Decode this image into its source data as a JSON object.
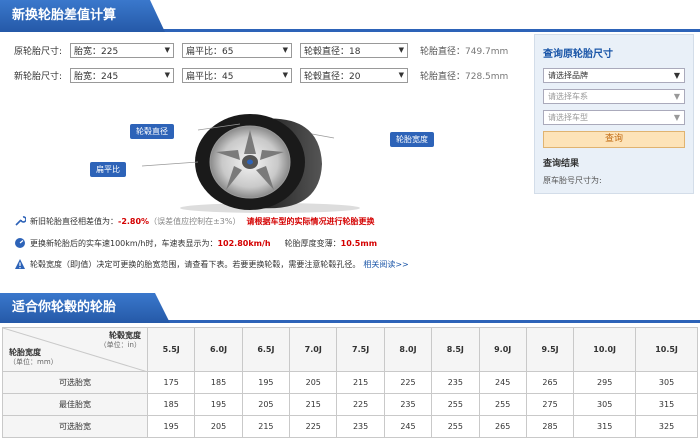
{
  "header": {
    "title": "新换轮胎差值计算"
  },
  "calc": {
    "original": {
      "label": "原轮胎尺寸:",
      "width_label": "胎宽：225",
      "ratio_label": "扁平比：65",
      "rim_label": "轮毂直径：18",
      "diameter_label": "轮胎直径：",
      "diameter_value": "749.7mm"
    },
    "new": {
      "label": "新轮胎尺寸:",
      "width_label": "胎宽：245",
      "ratio_label": "扁平比：45",
      "rim_label": "轮毂直径：20",
      "diameter_label": "轮胎直径：",
      "diameter_value": "728.5mm"
    }
  },
  "diagram": {
    "callout_rim": "轮毂直径",
    "callout_width": "轮胎宽度",
    "callout_ratio": "扁平比"
  },
  "sidebar": {
    "title": "查询原轮胎尺寸",
    "brand": "请选择品牌",
    "series": "请选择车系",
    "model": "请选择车型",
    "query_button": "查询",
    "result_title": "查询结果",
    "result_text": "原车胎号尺寸为:"
  },
  "info": {
    "line1_a": "新旧轮胎直径相差值为：",
    "line1_b": "-2.80%",
    "line1_c": "（误差值应控制在±3%）",
    "line1_d": "请根据车型的实际情况进行轮胎更换",
    "line2_a": "更换新轮胎后的实车速100km/h时，车速表显示为：",
    "line2_b": "102.80km/h",
    "line2_c": "轮胎厚度变薄：",
    "line2_d": "10.5mm",
    "line3_a": "轮毂宽度（即J值）决定可更换的胎宽范围，请查看下表。若要更换轮毂，需要注意轮毂孔径。",
    "line3_b": "相关阅读>>"
  },
  "section": {
    "title": "适合你轮毂的轮胎"
  },
  "table": {
    "corner_top": "轮毂宽度",
    "corner_top_unit": "（单位：in）",
    "corner_bottom": "轮胎宽度",
    "corner_bottom_unit": "（单位：mm）",
    "columns": [
      "5.5J",
      "6.0J",
      "6.5J",
      "7.0J",
      "7.5J",
      "8.0J",
      "8.5J",
      "9.0J",
      "9.5J",
      "10.0J",
      "10.5J"
    ],
    "rows": [
      {
        "label": "可选胎宽",
        "values": [
          "175",
          "185",
          "195",
          "205",
          "215",
          "225",
          "235",
          "245",
          "265",
          "295",
          "305"
        ]
      },
      {
        "label": "最佳胎宽",
        "values": [
          "185",
          "195",
          "205",
          "215",
          "225",
          "235",
          "255",
          "255",
          "275",
          "305",
          "315"
        ]
      },
      {
        "label": "可选胎宽",
        "values": [
          "195",
          "205",
          "215",
          "225",
          "235",
          "245",
          "255",
          "265",
          "285",
          "315",
          "325"
        ]
      }
    ]
  }
}
